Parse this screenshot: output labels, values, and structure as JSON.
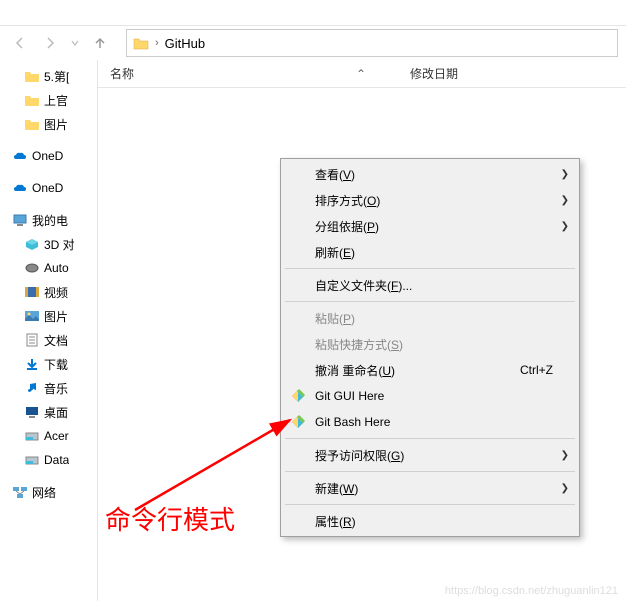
{
  "tabs": {
    "t1": "",
    "t2": ""
  },
  "breadcrumb": {
    "current": "GitHub"
  },
  "columns": {
    "name": "名称",
    "modified": "修改日期"
  },
  "sidebar": {
    "items": [
      {
        "label": "5.第[",
        "icon": "folder"
      },
      {
        "label": "上官",
        "icon": "folder"
      },
      {
        "label": "图片",
        "icon": "folder"
      }
    ],
    "onedrive": [
      {
        "label": "OneD",
        "icon": "onedrive"
      },
      {
        "label": "OneD",
        "icon": "onedrive"
      }
    ],
    "computer": {
      "label": "我的电",
      "icon": "pc"
    },
    "drives": [
      {
        "label": "3D 对",
        "icon": "3d"
      },
      {
        "label": "Auto",
        "icon": "autodesk"
      },
      {
        "label": "视频",
        "icon": "video"
      },
      {
        "label": "图片",
        "icon": "pictures"
      },
      {
        "label": "文档",
        "icon": "documents"
      },
      {
        "label": "下载",
        "icon": "downloads"
      },
      {
        "label": "音乐",
        "icon": "music"
      },
      {
        "label": "桌面",
        "icon": "desktop"
      },
      {
        "label": "Acer",
        "icon": "disk"
      },
      {
        "label": "Data",
        "icon": "disk"
      }
    ],
    "network": {
      "label": "网络",
      "icon": "network"
    }
  },
  "menu": {
    "view": "查看(V)",
    "sort": "排序方式(O)",
    "group": "分组依据(P)",
    "refresh": "刷新(E)",
    "customize": "自定义文件夹(F)...",
    "paste": "粘贴(P)",
    "paste_shortcut": "粘贴快捷方式(S)",
    "undo": "撤消 重命名(U)",
    "undo_key": "Ctrl+Z",
    "git_gui": "Git GUI Here",
    "git_bash": "Git Bash Here",
    "grant_access": "授予访问权限(G)",
    "new": "新建(W)",
    "properties": "属性(R)"
  },
  "annotation": "命令行模式",
  "watermark": "https://blog.csdn.net/zhuguanlin121"
}
